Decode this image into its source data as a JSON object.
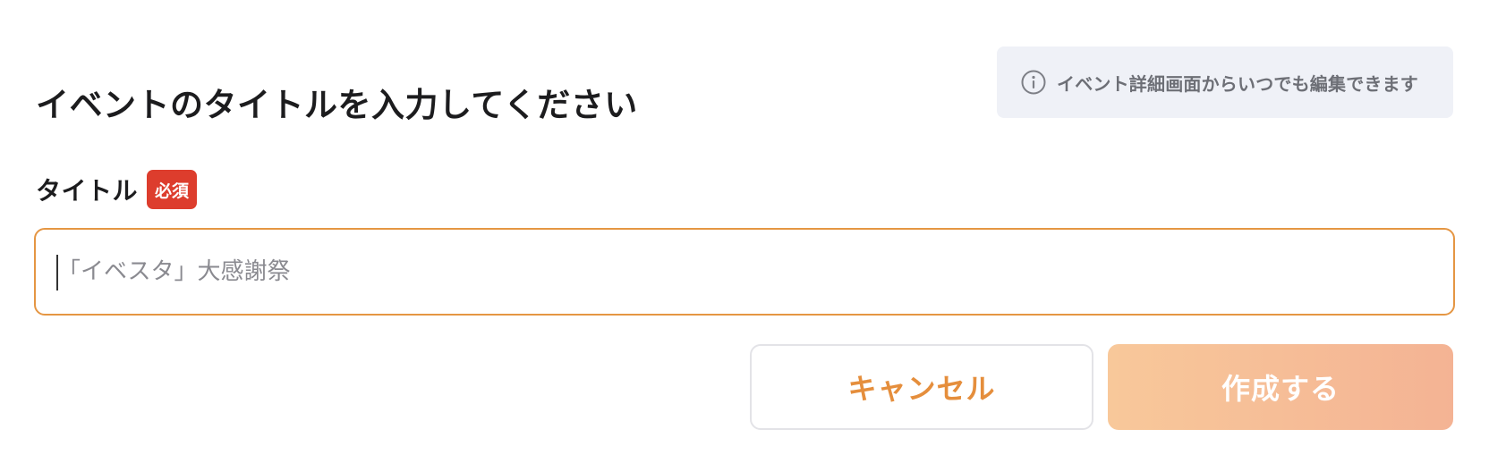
{
  "heading": {
    "title": "イベントのタイトルを入力してください"
  },
  "info": {
    "icon": "info-circle-icon",
    "text": "イベント詳細画面からいつでも編集できます"
  },
  "form": {
    "title_label": "タイトル",
    "required_badge": "必須",
    "title_value": "",
    "title_placeholder": "「イベスタ」大感謝祭"
  },
  "actions": {
    "cancel_label": "キャンセル",
    "create_label": "作成する"
  },
  "colors": {
    "accent": "#e58e3c",
    "input_border": "#e59643",
    "required": "#dd3d2d",
    "create_gradient_start": "#f8c89a",
    "create_gradient_end": "#f4b394",
    "info_background": "#eff1f7"
  }
}
